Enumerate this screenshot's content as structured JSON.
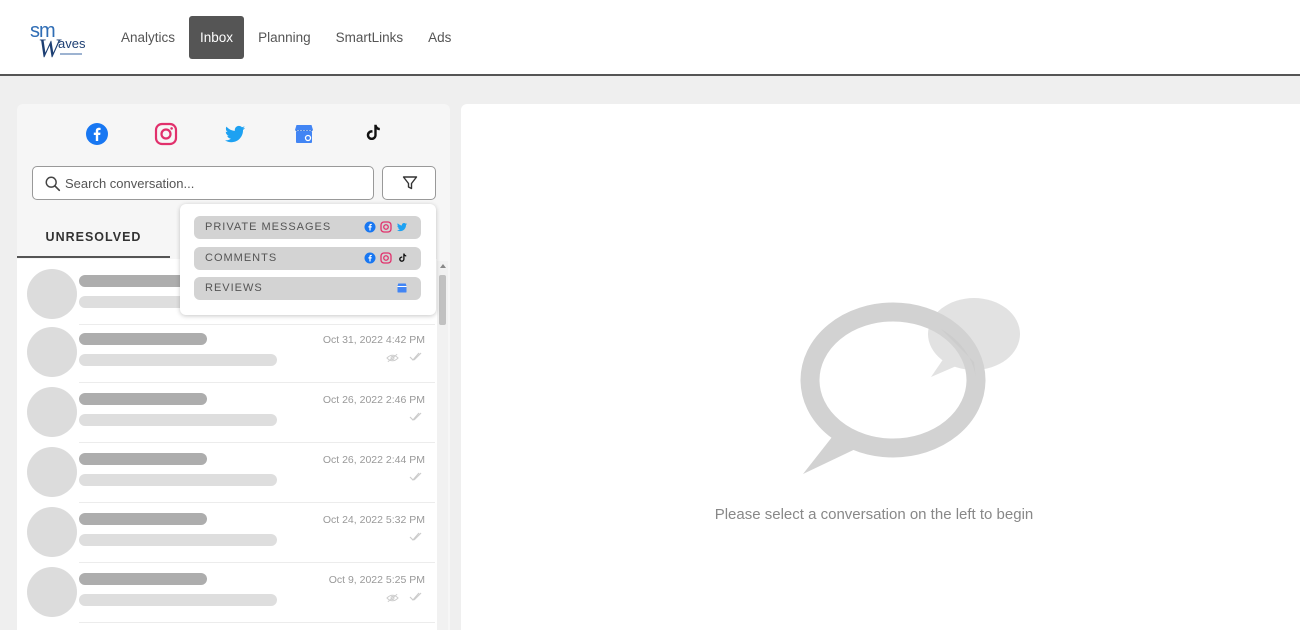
{
  "app": {
    "logo_text": "smwaves"
  },
  "nav": {
    "items": [
      {
        "label": "Analytics",
        "active": false
      },
      {
        "label": "Inbox",
        "active": true
      },
      {
        "label": "Planning",
        "active": false
      },
      {
        "label": "SmartLinks",
        "active": false
      },
      {
        "label": "Ads",
        "active": false
      }
    ]
  },
  "platforms": [
    {
      "icon": "facebook-icon",
      "color": "#1877f2"
    },
    {
      "icon": "instagram-icon",
      "color": "#e1306c"
    },
    {
      "icon": "twitter-icon",
      "color": "#1da1f2"
    },
    {
      "icon": "google-business-icon",
      "color": "#4285f4"
    },
    {
      "icon": "tiktok-icon",
      "color": "#000000"
    }
  ],
  "search": {
    "placeholder": "Search conversation..."
  },
  "tabs": {
    "unresolved": "UNRESOLVED"
  },
  "filter_menu": {
    "items": [
      {
        "label": "PRIVATE MESSAGES",
        "icons": [
          "facebook-icon",
          "instagram-icon",
          "twitter-icon"
        ]
      },
      {
        "label": "COMMENTS",
        "icons": [
          "facebook-icon",
          "instagram-icon",
          "tiktok-icon"
        ]
      },
      {
        "label": "REVIEWS",
        "icons": [
          "google-business-icon"
        ]
      }
    ]
  },
  "conversations": [
    {
      "date": "",
      "seen": false
    },
    {
      "date": "Oct 31, 2022 4:42 PM",
      "seen": true
    },
    {
      "date": "Oct 26, 2022 2:46 PM",
      "seen": false
    },
    {
      "date": "Oct 26, 2022 2:44 PM",
      "seen": false
    },
    {
      "date": "Oct 24, 2022 5:32 PM",
      "seen": false
    },
    {
      "date": "Oct 9, 2022 5:25 PM",
      "seen": true
    }
  ],
  "empty_state": {
    "message": "Please select a conversation on the left to begin"
  }
}
